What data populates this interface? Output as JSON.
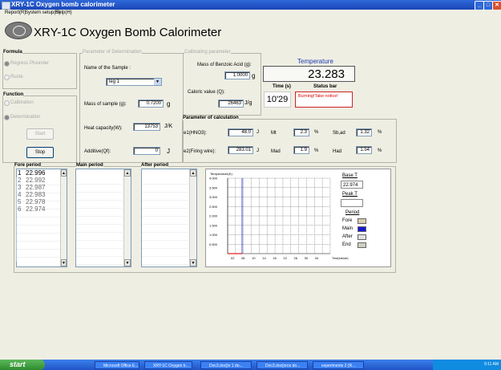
{
  "window": {
    "title": "XRY-1C Oxygen bomb calorimeter"
  },
  "menu": [
    "Report(R)",
    "System setup(S)",
    "Help(H)"
  ],
  "header": {
    "title": "XRY-1C Oxygen Bomb Calorimeter"
  },
  "formula": {
    "legend": "Formula",
    "options": [
      "Regress Plounder",
      "Ruste"
    ],
    "selected": 0
  },
  "function": {
    "legend": "Function",
    "options": [
      "Calibration",
      "Determination"
    ],
    "selected": 1,
    "start_label": "Start",
    "stop_label": "Stop"
  },
  "determination": {
    "legend": "Parameter of Determination",
    "sample_name_label": "Name of the Sample :",
    "sample_name_value": "leg 1",
    "mass_label": "Mass of sample (g):",
    "mass_value": "0.7200",
    "mass_unit": "g",
    "heat_label": "Heat capacity(W):",
    "heat_value": "13753",
    "heat_unit": "J/K",
    "additive_label": "Additive(Qf):",
    "additive_value": "0",
    "additive_unit": "J"
  },
  "calibrating": {
    "legend": "Calibrating parameter",
    "benzoic_label": "Mass of Benzoic Acid (g):",
    "benzoic_value": "1.0000",
    "benzoic_unit": "g",
    "caloric_label": "Caloric value (Q):",
    "caloric_value": "26463",
    "caloric_unit": "J/g"
  },
  "temperature": {
    "label": "Temperature",
    "value": "23.283",
    "time_label": "Time (s)",
    "time_value": "10'29",
    "status_label": "Status bar",
    "status_value": "Burning!Take notice!"
  },
  "calc": {
    "legend": "Parameter of calculation",
    "e1_label": "e1(HNO3):",
    "e1_value": "48.0",
    "e1_unit": "J",
    "e2_label": "e2(Firing wire):",
    "e2_value": "283.01",
    "e2_unit": "J",
    "mt_label": "Mt",
    "mt_value": "2.3",
    "mt_unit": "%",
    "mad_label": "Mad",
    "mad_value": "1.9",
    "mad_unit": "%",
    "sbad_label": "Sb,ad",
    "sbad_value": "1.32",
    "sbad_unit": "%",
    "had_label": "Had",
    "had_value": "1.54",
    "had_unit": "%"
  },
  "periods": {
    "fore_label": "Fore period",
    "main_label": "Main period",
    "after_label": "After period",
    "fore": [
      {
        "n": "1",
        "v": "22.996"
      },
      {
        "n": "2",
        "v": "22.992"
      },
      {
        "n": "3",
        "v": "22.987"
      },
      {
        "n": "4",
        "v": "22.983"
      },
      {
        "n": "5",
        "v": "22.978"
      },
      {
        "n": "6",
        "v": "22.974"
      }
    ]
  },
  "graph": {
    "ylabel": "Temperature(K)",
    "xlabel": "Time(minute)",
    "y_ticks": [
      "4.000",
      "3.500",
      "3.000",
      "2.500",
      "2.000",
      "1.500",
      "1.000",
      "0.500"
    ],
    "x_ticks": [
      "02",
      "06",
      "10",
      "14",
      "18",
      "22",
      "26",
      "30",
      "34"
    ],
    "base_label": "Base T",
    "base_value": "22.974",
    "peak_label": "Peak T",
    "peak_value": "",
    "period_label": "Period",
    "legend": [
      {
        "name": "Fore",
        "color": "#d9ccb0"
      },
      {
        "name": "Main",
        "color": "#1818d0"
      },
      {
        "name": "After",
        "color": "#e0e0e0"
      },
      {
        "name": "End",
        "color": "#cfcfc0"
      }
    ]
  },
  "taskbar": {
    "start": "start",
    "tasks": [
      "Microsoft Office E...",
      "XRY-1C Oxygen b...",
      "Doc3.doc[in 1 do...",
      "Doc3.doc[orce do...",
      "experiments 2 (R..."
    ],
    "clock": "9:11 AM"
  }
}
